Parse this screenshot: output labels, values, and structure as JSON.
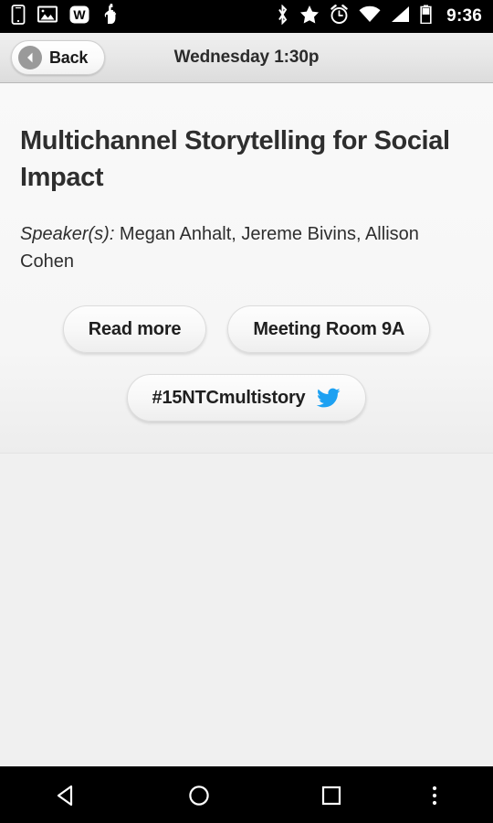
{
  "statusbar": {
    "time": "9:36",
    "left_icons": [
      {
        "name": "device-phone-icon"
      },
      {
        "name": "image-photo-icon"
      },
      {
        "name": "wikipedia-w-icon",
        "glyph": "W"
      },
      {
        "name": "hand-touch-icon"
      }
    ],
    "right_icons": [
      {
        "name": "bluetooth-icon"
      },
      {
        "name": "star-icon"
      },
      {
        "name": "alarm-clock-icon"
      },
      {
        "name": "wifi-icon"
      },
      {
        "name": "cellular-signal-icon"
      },
      {
        "name": "battery-icon"
      }
    ]
  },
  "header": {
    "back_label": "Back",
    "title": "Wednesday 1:30p"
  },
  "session": {
    "title": "Multichannel Storytelling for Social Impact",
    "speakers_label": "Speaker(s):",
    "speakers_names": " Megan Anhalt, Jereme Bivins, Allison Cohen",
    "buttons": {
      "read_more": "Read more",
      "room": "Meeting Room 9A",
      "hashtag": "#15NTCmultistory"
    }
  },
  "colors": {
    "twitter_blue": "#1DA1F2",
    "header_bottom": "#dcdcdc",
    "page_bg": "#f0f0f0",
    "card_bg": "#f8f8f8",
    "text_dark": "#2e2e2e"
  },
  "navbar": {
    "items": [
      {
        "name": "nav-back-button",
        "icon": "triangle-left-icon"
      },
      {
        "name": "nav-home-button",
        "icon": "circle-icon"
      },
      {
        "name": "nav-recents-button",
        "icon": "square-icon"
      },
      {
        "name": "nav-overflow-button",
        "icon": "three-dots-vertical-icon"
      }
    ]
  }
}
